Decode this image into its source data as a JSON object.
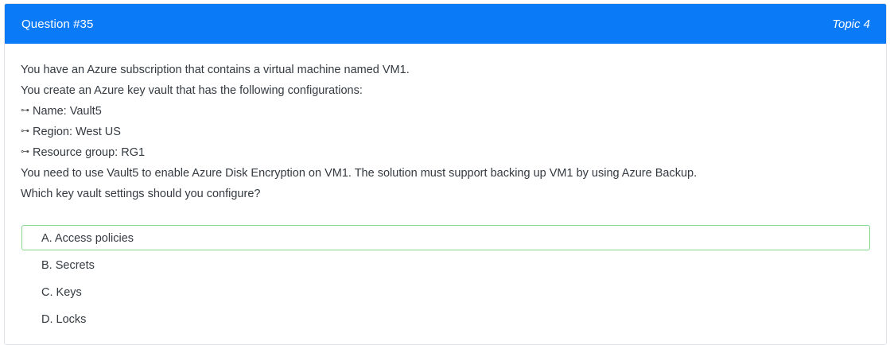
{
  "header": {
    "question_label": "Question #35",
    "topic_label": "Topic 4",
    "bg_color": "#0b7af6"
  },
  "question": {
    "intro": "You have an Azure subscription that contains a virtual machine named VM1.",
    "setup": "You create an Azure key vault that has the following configurations:",
    "bullets": [
      {
        "icon": "⊶",
        "text": "Name: Vault5"
      },
      {
        "icon": "⊶",
        "text": "Region: West US"
      },
      {
        "icon": "⊶",
        "text": "Resource group: RG1"
      }
    ],
    "requirement": "You need to use Vault5 to enable Azure Disk Encryption on VM1. The solution must support backing up VM1 by using Azure Backup.",
    "prompt": "Which key vault settings should you configure?"
  },
  "choices": [
    {
      "label": "A. Access policies",
      "highlighted": true
    },
    {
      "label": "B. Secrets",
      "highlighted": false
    },
    {
      "label": "C. Keys",
      "highlighted": false
    },
    {
      "label": "D. Locks",
      "highlighted": false
    }
  ],
  "colors": {
    "highlight_border": "#84d98f",
    "text": "#343a40"
  }
}
